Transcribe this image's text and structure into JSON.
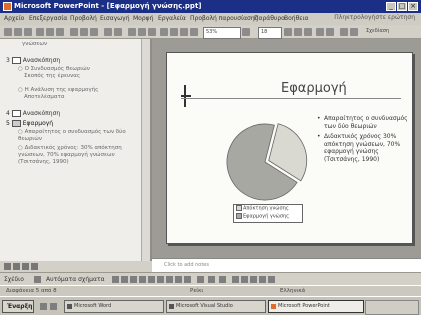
{
  "window": {
    "title": "Microsoft PowerPoint - [Εφαρμογή γνώσης.ppt]",
    "buttons": [
      "_",
      "□",
      "×"
    ]
  },
  "menu": {
    "items": [
      "Αρχείο",
      "Επεξεργασία",
      "Προβολή",
      "Εισαγωγή",
      "Μορφή",
      "Εργαλεία",
      "Προβολή παρουσίασης",
      "Παράθυρο",
      "Βοήθεια"
    ],
    "help_hint": "Πληκτρολογήστε ερώτηση"
  },
  "toolbar": {
    "zoom": "53%",
    "font_size": "18",
    "design_label": "Σχεδίαση"
  },
  "outline": {
    "items": [
      {
        "text": "γνώσεων",
        "level": 2
      },
      {
        "text": "Ανασκόπηση",
        "level": 1,
        "number": "3"
      },
      {
        "text": "Ο Συνδυασμός θεωριών",
        "level": 2
      },
      {
        "text": "Σκοπός της έρευνας",
        "level": 2
      },
      {
        "text": "Η Ανάλυση της εφαρμογής",
        "level": 2
      },
      {
        "text": "Αποτελέσματα",
        "level": 2
      },
      {
        "text": "Ανασκόπηση",
        "level": 1,
        "number": "4"
      },
      {
        "text": "Εφαρμογή",
        "level": 1,
        "number": "5"
      },
      {
        "text": "Απαραίτητος ο συνδυασμός των δύο θεωριών",
        "level": 2
      },
      {
        "text": "Διδακτικός χρόνος: 30% απόκτηση γνώσεων, 70% εφαρμογή γνώσεων (Τσιτσάνης, 1990)",
        "level": 2
      }
    ]
  },
  "slide": {
    "title": "Εφαρμογή",
    "bullets": [
      "Απαραίτητος ο συνδυασμός των δύο θεωριών",
      "Διδακτικός χρόνος 30% απόκτηση γνώσεων, 70% εφαρμογή γνώσης (Τσιτσάνης, 1990)"
    ]
  },
  "chart_data": {
    "type": "pie",
    "values": [
      30,
      70
    ],
    "labels": [
      "Απόκτηση γνώσης",
      "Εφαρμογή γνώσης"
    ],
    "colors": [
      "#d9d9d2",
      "#a8a8a2"
    ]
  },
  "notes": {
    "placeholder": "Click to add notes"
  },
  "drawbar": {
    "draw_label": "Σχέδιο",
    "autoshapes_label": "Αυτόματα σχήματα"
  },
  "status": {
    "slide": "Διαφάνεια 5 από 8",
    "design": "Ρείκι",
    "language": "Ελληνικά"
  },
  "taskbar": {
    "start": "Έναρξη",
    "tasks": [
      "Microsoft Word",
      "Microsoft Visual Studio",
      "Microsoft PowerPoint"
    ]
  },
  "colors": {
    "title_bar": "#1c2f86",
    "accent": "#e06b2a"
  }
}
